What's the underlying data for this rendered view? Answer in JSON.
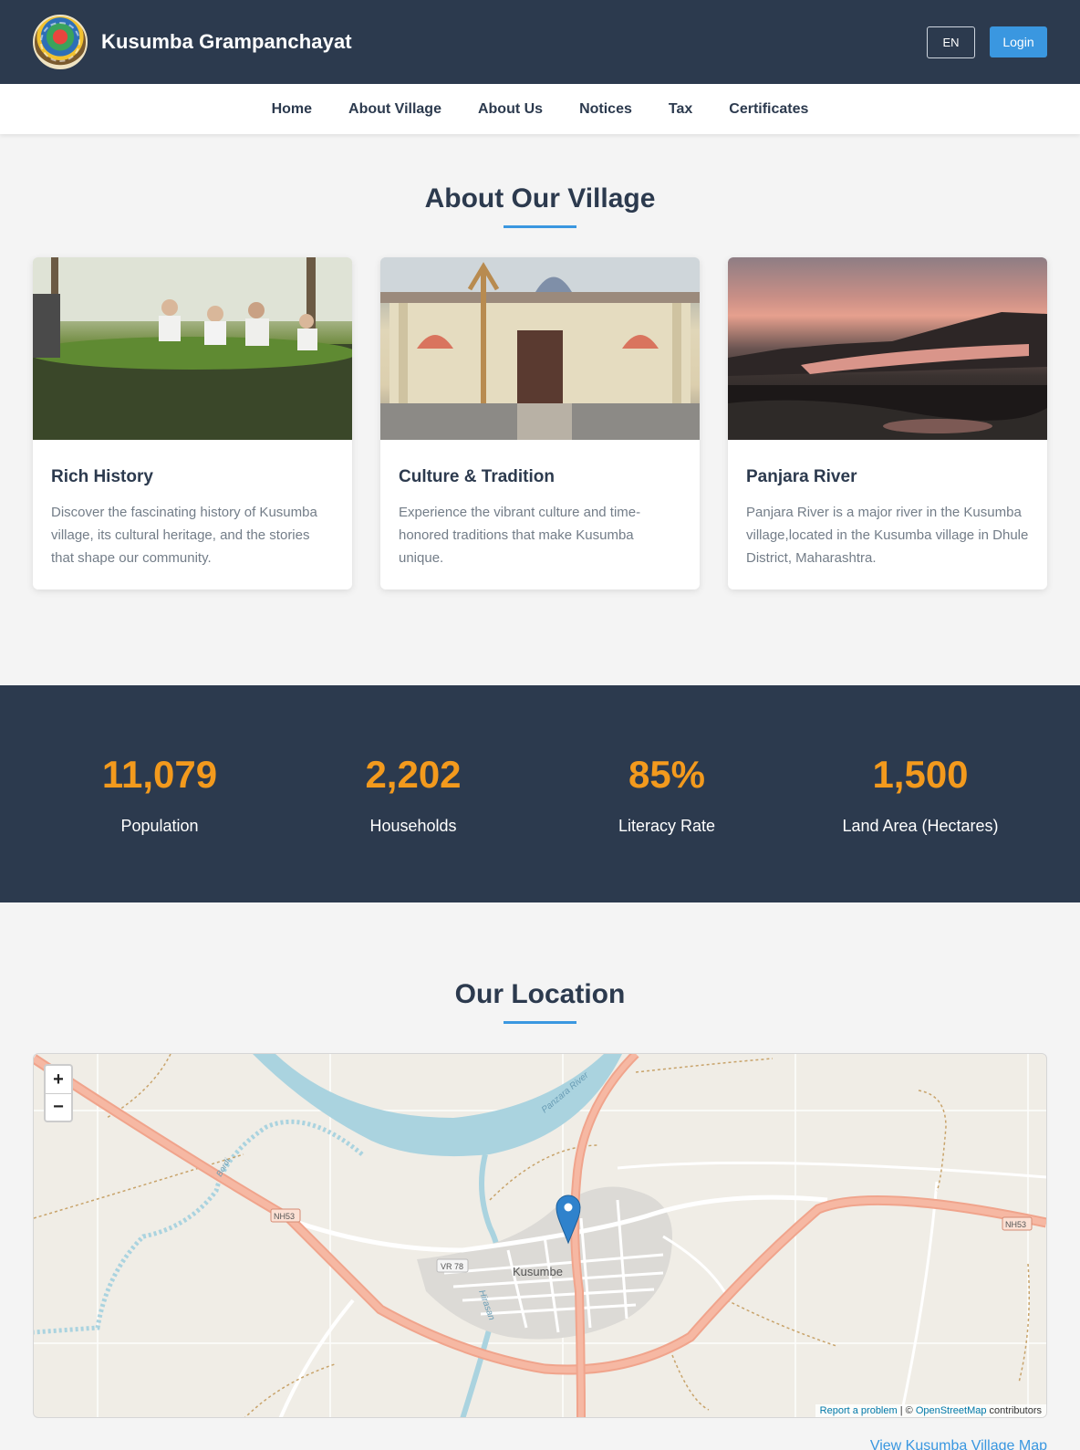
{
  "header": {
    "title": "Kusumba Grampanchayat",
    "lang_label": "EN",
    "login_label": "Login"
  },
  "nav": {
    "items": [
      {
        "label": "Home"
      },
      {
        "label": "About Village"
      },
      {
        "label": "About Us"
      },
      {
        "label": "Notices"
      },
      {
        "label": "Tax"
      },
      {
        "label": "Certificates"
      }
    ]
  },
  "about": {
    "title": "About Our Village",
    "cards": [
      {
        "title": "Rich History",
        "text": "Discover the fascinating history of Kusumba village, its cultural heritage, and the stories that shape our community."
      },
      {
        "title": "Culture & Tradition",
        "text": "Experience the vibrant culture and time-honored traditions that make Kusumba unique."
      },
      {
        "title": "Panjara River",
        "text": "Panjara River is a major river in the Kusumba village,located in the Kusumba village in Dhule District, Maharashtra."
      }
    ]
  },
  "stats": [
    {
      "value": "11,079",
      "label": "Population"
    },
    {
      "value": "2,202",
      "label": "Households"
    },
    {
      "value": "85%",
      "label": "Literacy Rate"
    },
    {
      "value": "1,500",
      "label": "Land Area (Hectares)"
    }
  ],
  "location": {
    "title": "Our Location",
    "zoom_in": "+",
    "zoom_out": "−",
    "map_labels": {
      "town": "Kusumbe",
      "river": "Panzara River",
      "stream1": "Hirasan",
      "stream2": "Bordi",
      "road1": "NH53",
      "road2": "NH53",
      "road3": "VR 78"
    },
    "attribution_report": "Report a problem",
    "attribution_sep": " | © ",
    "attribution_osm": "OpenStreetMap",
    "attribution_tail": " contributors",
    "map_link": "View Kusumba Village Map"
  },
  "colors": {
    "header_bg": "#2c3a4e",
    "accent": "#3a97e0",
    "stat_value": "#f39a1d"
  }
}
